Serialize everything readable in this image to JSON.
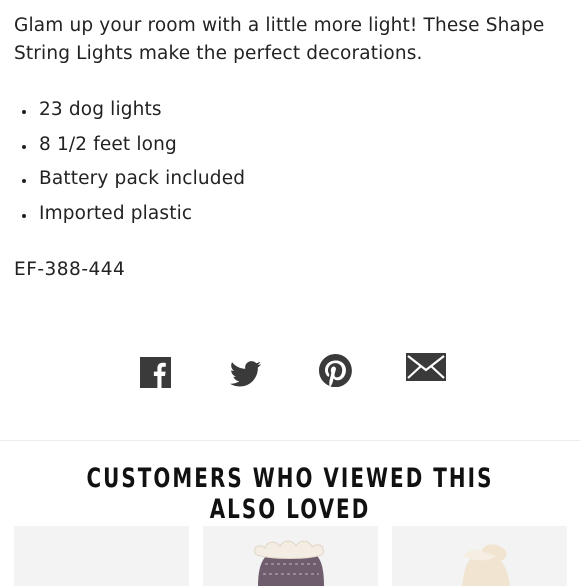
{
  "product": {
    "description": "Glam up your room with a little more light! These Shape String Lights make the perfect decorations.",
    "features": [
      "23 dog lights",
      "8 1/2 feet long",
      "Battery pack included",
      "Imported plastic"
    ],
    "sku": "EF-388-444"
  },
  "share": {
    "buttons": [
      {
        "icon": "facebook-icon"
      },
      {
        "icon": "twitter-icon"
      },
      {
        "icon": "pinterest-icon"
      },
      {
        "icon": "email-icon"
      }
    ],
    "icon_color": "#3a3a3a"
  },
  "recommendations": {
    "title": "CUSTOMERS WHO VIEWED THIS ALSO LOVED",
    "products": [
      {
        "image": "product-image-blank"
      },
      {
        "image": "slipper-sock-purple"
      },
      {
        "image": "slipper-sock-cream"
      }
    ]
  }
}
